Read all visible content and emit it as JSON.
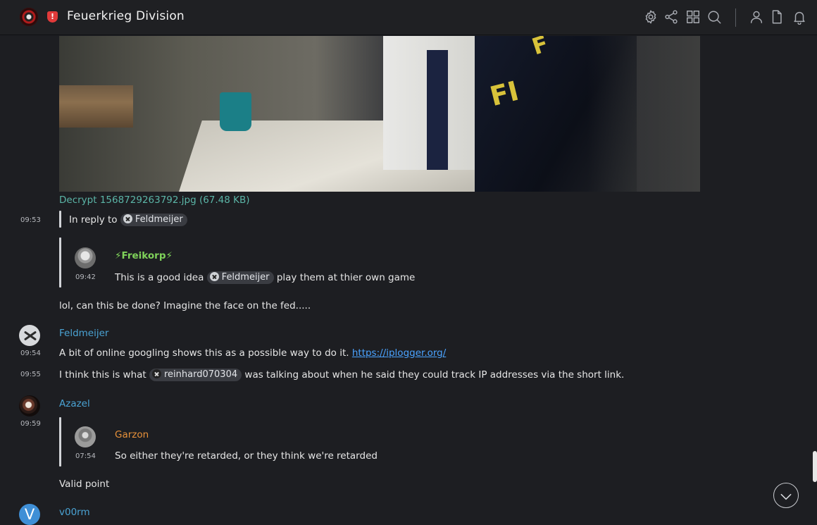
{
  "header": {
    "channel_title": "Feuerkrieg Division",
    "icons": [
      "settings-icon",
      "share-icon",
      "grid-icon",
      "search-icon",
      "user-icon",
      "file-icon",
      "bell-icon"
    ]
  },
  "attachment": {
    "file_link": "Decrypt 1568729263792.jpg (67.48 KB)"
  },
  "messages": {
    "m1": {
      "time": "09:53",
      "reply_prefix": "In reply to",
      "reply_mention": "Feldmeijer",
      "quote": {
        "author": "⚡Freikorp⚡",
        "time": "09:42",
        "text_before": "This is a good idea",
        "mention": "Feldmeijer",
        "text_after": "play them at thier own game"
      },
      "text": "lol, can this be done? Imagine the face on the fed....."
    },
    "m2": {
      "author": "Feldmeijer",
      "time": "09:54",
      "text": "A bit of online googling shows this as a possible way to do it.",
      "link": "https://iplogger.org/"
    },
    "m3": {
      "time": "09:55",
      "text_before": "I think this is what",
      "mention": "reinhard070304",
      "text_after": "was talking about when he said they could track IP addresses via the short link."
    },
    "m4": {
      "author": "Azazel",
      "time": "09:59",
      "quote": {
        "author": "Garzon",
        "time": "07:54",
        "text": "So either they're retarded, or they think we're retarded"
      },
      "text": "Valid point"
    },
    "m5": {
      "author": "v00rm",
      "avatar_letter": "V"
    }
  },
  "colors": {
    "background": "#1d1e22",
    "accent_teal": "#5bb5a7",
    "author_blue": "#4aa3d4",
    "author_orange": "#e7913a",
    "freikorp_green": "#7fd25a",
    "link": "#4aa3ff"
  }
}
